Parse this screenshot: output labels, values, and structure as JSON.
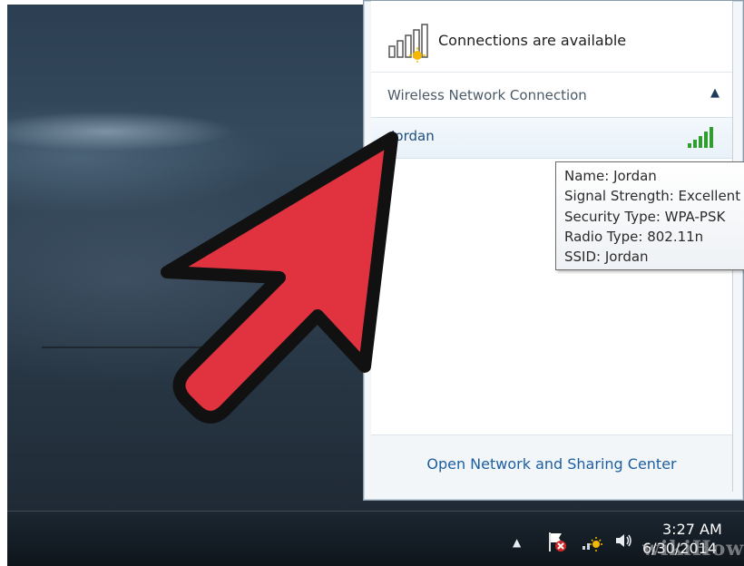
{
  "flyout": {
    "title": "Connections are available",
    "section_label": "Wireless Network Connection",
    "network_name": "Jordan",
    "footer_link": "Open Network and Sharing Center"
  },
  "tooltip": {
    "lines": [
      "Name: Jordan",
      "Signal Strength: Excellent",
      "Security Type: WPA-PSK",
      "Radio Type: 802.11n",
      "SSID: Jordan"
    ]
  },
  "taskbar": {
    "time": "3:27 AM",
    "date": "6/30/2014",
    "watermark": "wikiHow"
  },
  "colors": {
    "arrow_fill": "#e1333f",
    "arrow_outline": "#111111",
    "signal_green": "#2f9e2f",
    "link_blue": "#1c5fa0"
  },
  "icons": {
    "header": "network-signal-icon",
    "network": "signal-bars-icon",
    "tray": [
      "show-hidden-icons-arrow",
      "action-center-flag-icon",
      "wifi-tray-icon",
      "volume-icon"
    ]
  }
}
